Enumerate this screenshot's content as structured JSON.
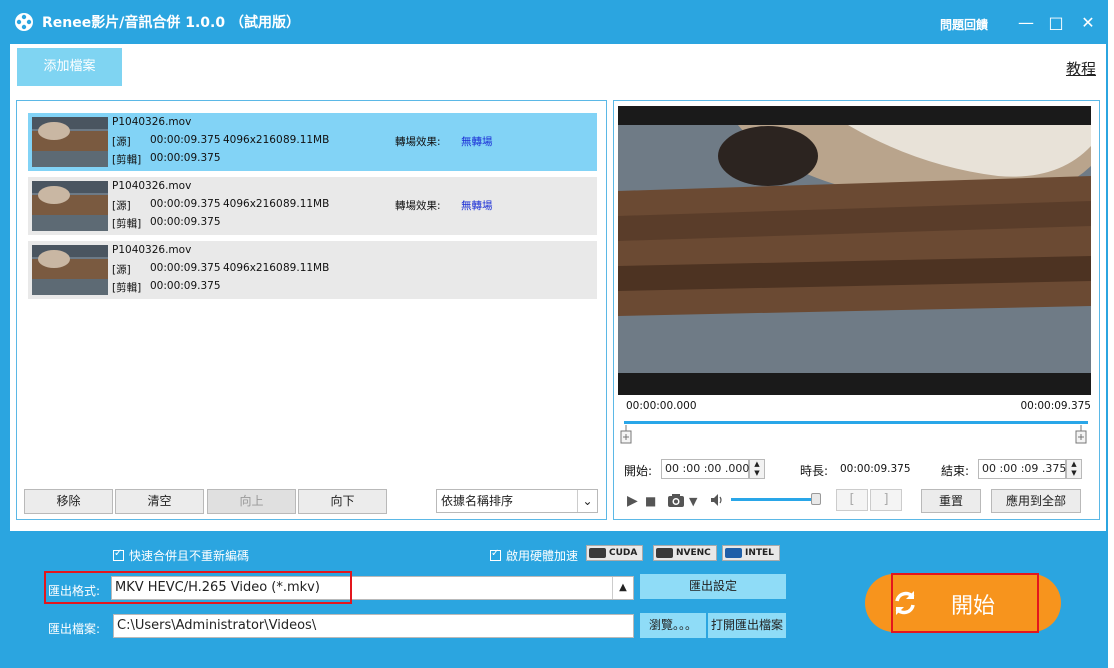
{
  "window": {
    "title": "Renee影片/音訊合併 1.0.0 （試用版）",
    "feedback": "問題回饋",
    "minimize": "—",
    "maximize": "□",
    "close": "✕"
  },
  "toolbar": {
    "add_file": "添加檔案",
    "tutorial": "教程"
  },
  "files": [
    {
      "name": "P1040326.mov",
      "src_label": "[源]",
      "src_duration": "00:00:09.375",
      "resolution": "4096x2160",
      "size": "89.11MB",
      "transition_label": "轉場效果:",
      "transition_value": "無轉場",
      "cut_label": "[剪輯]",
      "cut_duration": "00:00:09.375"
    },
    {
      "name": "P1040326.mov",
      "src_label": "[源]",
      "src_duration": "00:00:09.375",
      "resolution": "4096x2160",
      "size": "89.11MB",
      "transition_label": "轉場效果:",
      "transition_value": "無轉場",
      "cut_label": "[剪輯]",
      "cut_duration": "00:00:09.375"
    },
    {
      "name": "P1040326.mov",
      "src_label": "[源]",
      "src_duration": "00:00:09.375",
      "resolution": "4096x2160",
      "size": "89.11MB",
      "cut_label": "[剪輯]",
      "cut_duration": "00:00:09.375"
    }
  ],
  "list_buttons": {
    "remove": "移除",
    "clear": "清空",
    "up": "向上",
    "down": "向下",
    "sort": "依據名稱排序",
    "sort_arrow": "⌄"
  },
  "preview": {
    "time_start": "00:00:00.000",
    "time_end": "00:00:09.375",
    "start_label": "開始:",
    "start_value": "00 :00 :00 .000",
    "duration_label": "時長:",
    "duration_value": "00:00:09.375",
    "end_label": "結束:",
    "end_value": "00 :00 :09 .375",
    "reset": "重置",
    "apply_all": "應用到全部",
    "bracket_left": "[",
    "bracket_right": "]",
    "play_icon": "▶",
    "stop_icon": "■",
    "dropdown_icon": "▼"
  },
  "bottom": {
    "fast_merge": "快速合併且不重新編碼",
    "hw_accel": "啟用硬體加速",
    "cuda": "CUDA",
    "nvenc": "NVENC",
    "intel": "INTEL",
    "format_label": "匯出格式:",
    "format_value": "MKV HEVC/H.265 Video (*.mkv)",
    "format_arrow": "▲",
    "export_settings": "匯出設定",
    "file_label": "匯出檔案:",
    "file_value": "C:\\Users\\Administrator\\Videos\\",
    "browse": "瀏覽。。。",
    "open_folder": "打開匯出檔案",
    "start": "開始"
  },
  "colors": {
    "app_bg": "#2ba5e0",
    "accent": "#29a6e8",
    "selected_row": "#82d3f6",
    "start_button": "#f7941d",
    "highlight_box": "#e3161d"
  }
}
